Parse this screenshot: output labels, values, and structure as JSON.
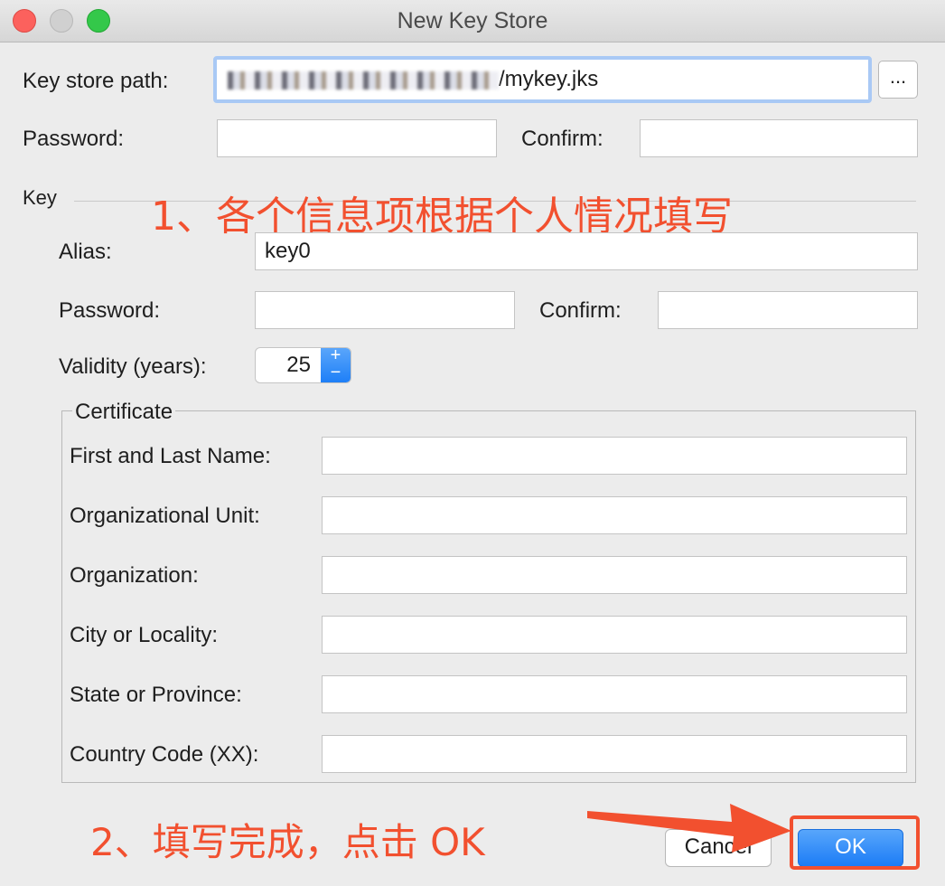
{
  "window": {
    "title": "New Key Store"
  },
  "keystore": {
    "path_label": "Key store path:",
    "path_suffix": "/mykey.jks",
    "browse_label": "...",
    "password_label": "Password:",
    "confirm_label": "Confirm:"
  },
  "key": {
    "section_label": "Key",
    "alias_label": "Alias:",
    "alias_value": "key0",
    "password_label": "Password:",
    "confirm_label": "Confirm:",
    "validity_label": "Validity (years):",
    "validity_value": "25",
    "spinner_up": "+",
    "spinner_down": "−"
  },
  "certificate": {
    "title": "Certificate",
    "fields": [
      {
        "label": "First and Last Name:"
      },
      {
        "label": "Organizational Unit:"
      },
      {
        "label": "Organization:"
      },
      {
        "label": "City or Locality:"
      },
      {
        "label": "State or Province:"
      },
      {
        "label": "Country Code (XX):"
      }
    ]
  },
  "buttons": {
    "cancel": "Cancel",
    "ok": "OK"
  },
  "annotations": {
    "step1": "1、各个信息项根据个人情况填写",
    "step2": "2、填写完成，点击 OK",
    "color": "#f2502f"
  }
}
